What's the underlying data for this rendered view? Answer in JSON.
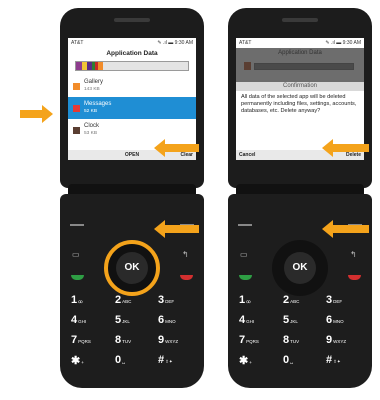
{
  "colors": {
    "accent": "#f4a31b",
    "selection": "#1f8ed4",
    "phone_body": "#1c1c1c"
  },
  "left_phone": {
    "status": {
      "carrier": "AT&T",
      "icons": "✎ .ıl ▬ 9:30 AM"
    },
    "title": "Application Data",
    "storage_segments": [
      {
        "color": "#8e3c8e",
        "fraction": 0.05
      },
      {
        "color": "#f1c533",
        "fraction": 0.05
      },
      {
        "color": "#5b2a86",
        "fraction": 0.04
      },
      {
        "color": "#2e7d32",
        "fraction": 0.03
      },
      {
        "color": "#c62828",
        "fraction": 0.03
      },
      {
        "color": "#f28c2a",
        "fraction": 0.04
      }
    ],
    "items": [
      {
        "name": "Gallery",
        "size": "143 KB",
        "color": "#f28c2a"
      },
      {
        "name": "Messages",
        "size": "52 KB",
        "color": "#e53935"
      },
      {
        "name": "Clock",
        "size": "53 KB",
        "color": "#5a3e32"
      }
    ],
    "softkeys": {
      "left": "",
      "center": "OPEN",
      "right": "Clear"
    },
    "ok_label": "OK"
  },
  "right_phone": {
    "status": {
      "carrier": "AT&T",
      "icons": "✎ .ıl ▬ 9:30 AM"
    },
    "title": "Application Data",
    "dialog_title": "Confirmation",
    "dialog_body": "All data of the selected app will be deleted permanently including files, settings, accounts, databases, etc. Delete anyway?",
    "softkeys": {
      "left": "Cancel",
      "center": "",
      "right": "Delete"
    },
    "ok_label": "OK"
  },
  "keypad": [
    {
      "num": "1",
      "sub": "ꝏ"
    },
    {
      "num": "2",
      "sub": "ABC"
    },
    {
      "num": "3",
      "sub": "DEF"
    },
    {
      "num": "4",
      "sub": "GHI"
    },
    {
      "num": "5",
      "sub": "JKL"
    },
    {
      "num": "6",
      "sub": "MNO"
    },
    {
      "num": "7",
      "sub": "PQRS"
    },
    {
      "num": "8",
      "sub": "TUV"
    },
    {
      "num": "9",
      "sub": "WXYZ"
    },
    {
      "num": "✱",
      "sub": "+"
    },
    {
      "num": "0",
      "sub": "␣"
    },
    {
      "num": "#",
      "sub": "⇧✦"
    }
  ],
  "icons": {
    "menu": "menu-icon",
    "back": "back-icon",
    "call": "call-icon",
    "end": "end-call-icon"
  }
}
